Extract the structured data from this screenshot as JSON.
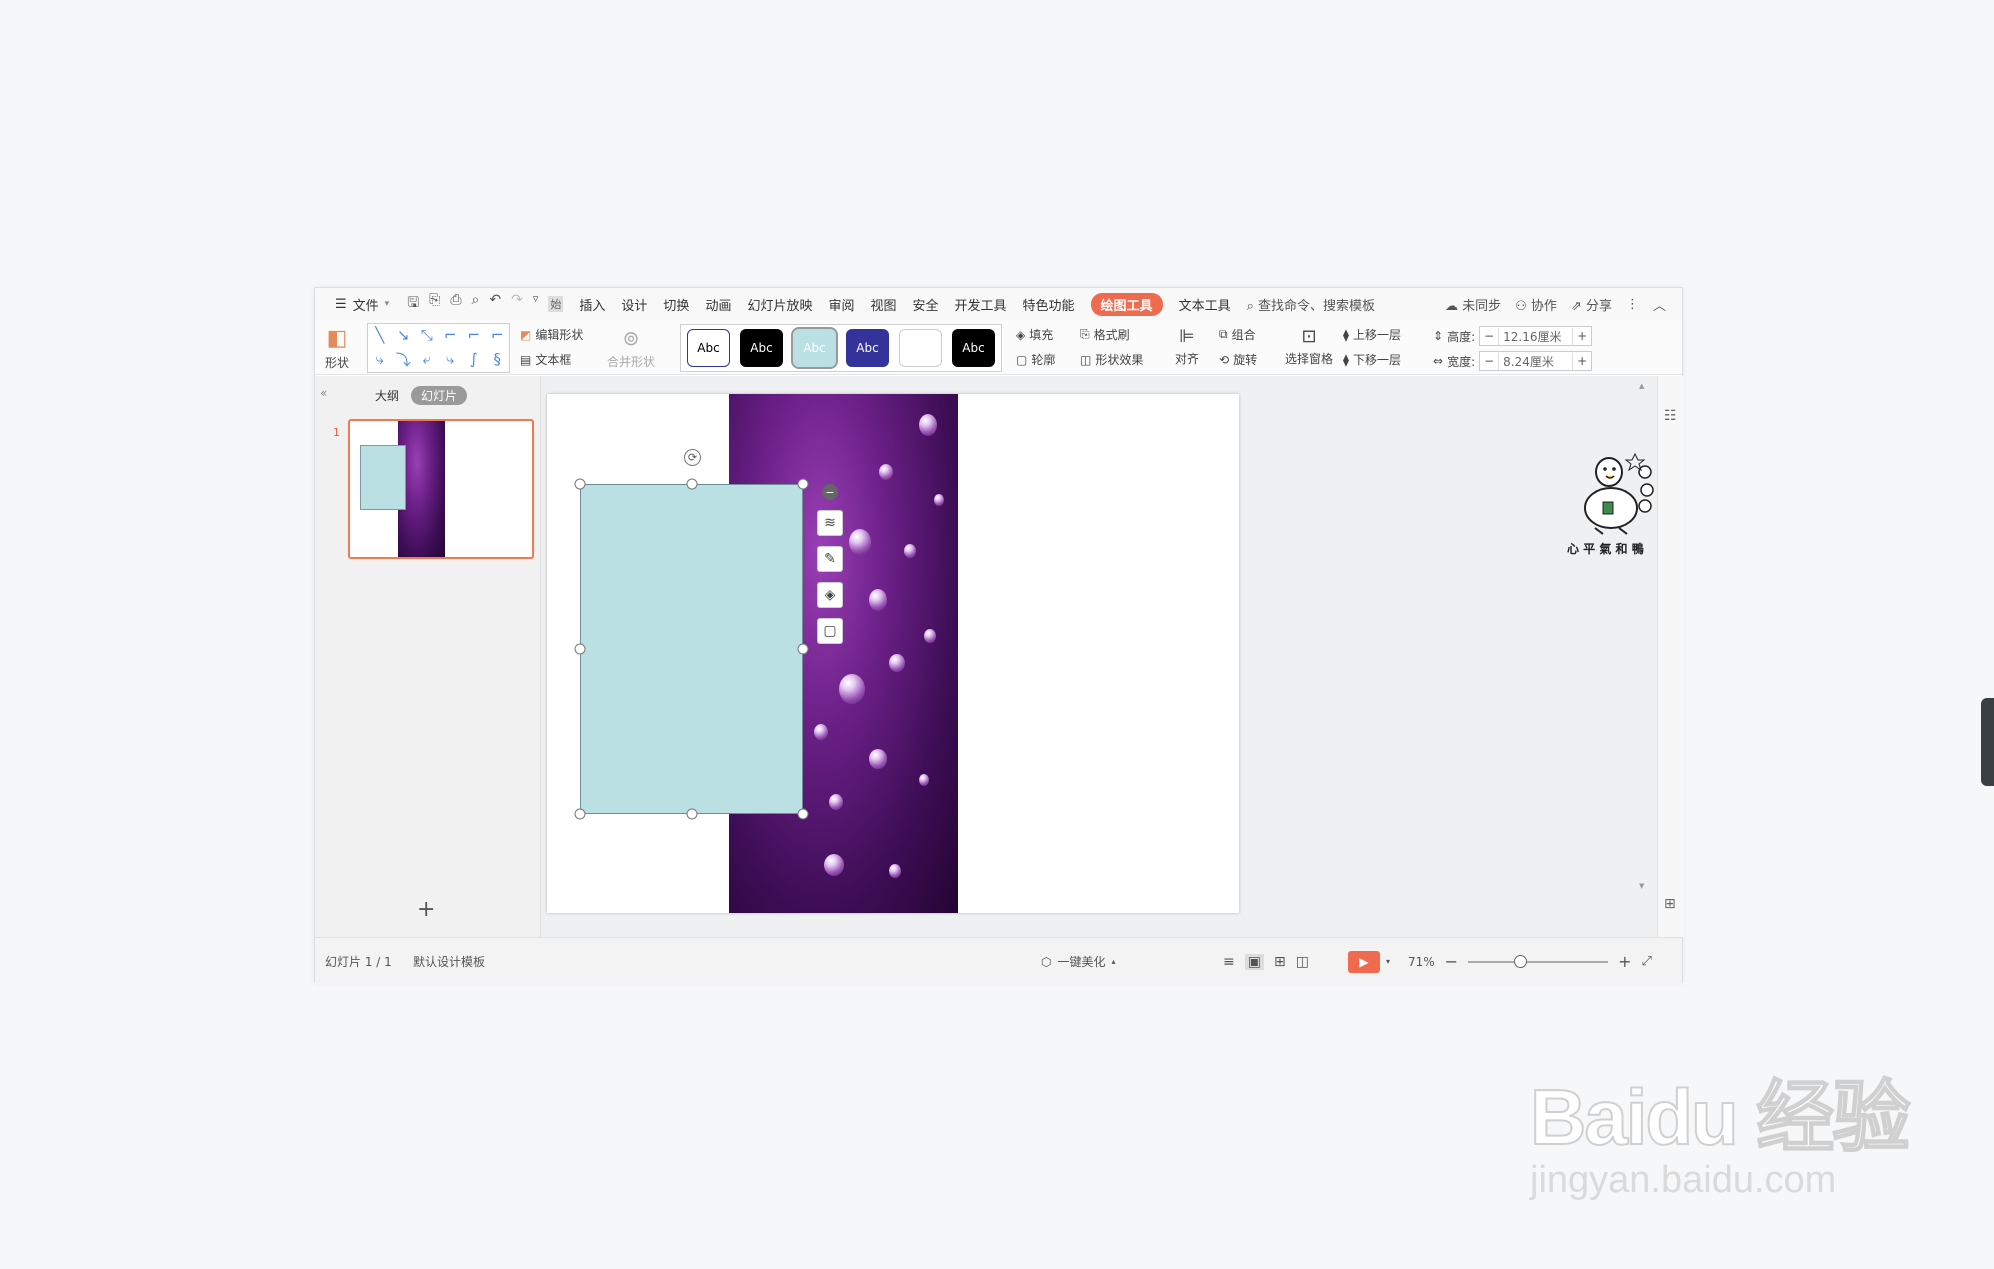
{
  "menubar": {
    "file": "文件",
    "tabs": [
      "插入",
      "设计",
      "切换",
      "动画",
      "幻灯片放映",
      "审阅",
      "视图",
      "安全",
      "开发工具",
      "特色功能",
      "绘图工具",
      "文本工具"
    ],
    "partial_tab": "始",
    "active_tab": "绘图工具",
    "search": "查找命令、搜索模板",
    "sync": "未同步",
    "collab": "协作",
    "share": "分享"
  },
  "ribbon": {
    "shape_label": "形状",
    "edit_shape": "编辑形状",
    "textbox": "文本框",
    "merge_shape": "合并形状",
    "style_label": "Abc",
    "fill": "填充",
    "format_brush": "格式刷",
    "outline": "轮廓",
    "shape_effect": "形状效果",
    "align": "对齐",
    "group": "组合",
    "rotate": "旋转",
    "selection_pane": "选择窗格",
    "bring_forward": "上移一层",
    "send_backward": "下移一层",
    "height_label": "高度:",
    "height_value": "12.16厘米",
    "width_label": "宽度:",
    "width_value": "8.24厘米",
    "colors": {
      "swatches": [
        "#ffffff",
        "#000000",
        "#bae0e4",
        "#333399",
        "#ffffff",
        "#000000"
      ]
    }
  },
  "leftpane": {
    "tab_outline": "大纲",
    "tab_slides": "幻灯片",
    "slide_number": "1"
  },
  "statusbar": {
    "slide_info": "幻灯片 1 / 1",
    "template": "默认设计模板",
    "beautify": "一键美化",
    "zoom": "71%"
  },
  "sticker_text": "心 平 氣 和 鴨",
  "watermark": {
    "main": "Baidu 经验",
    "sub": "jingyan.baidu.com"
  }
}
